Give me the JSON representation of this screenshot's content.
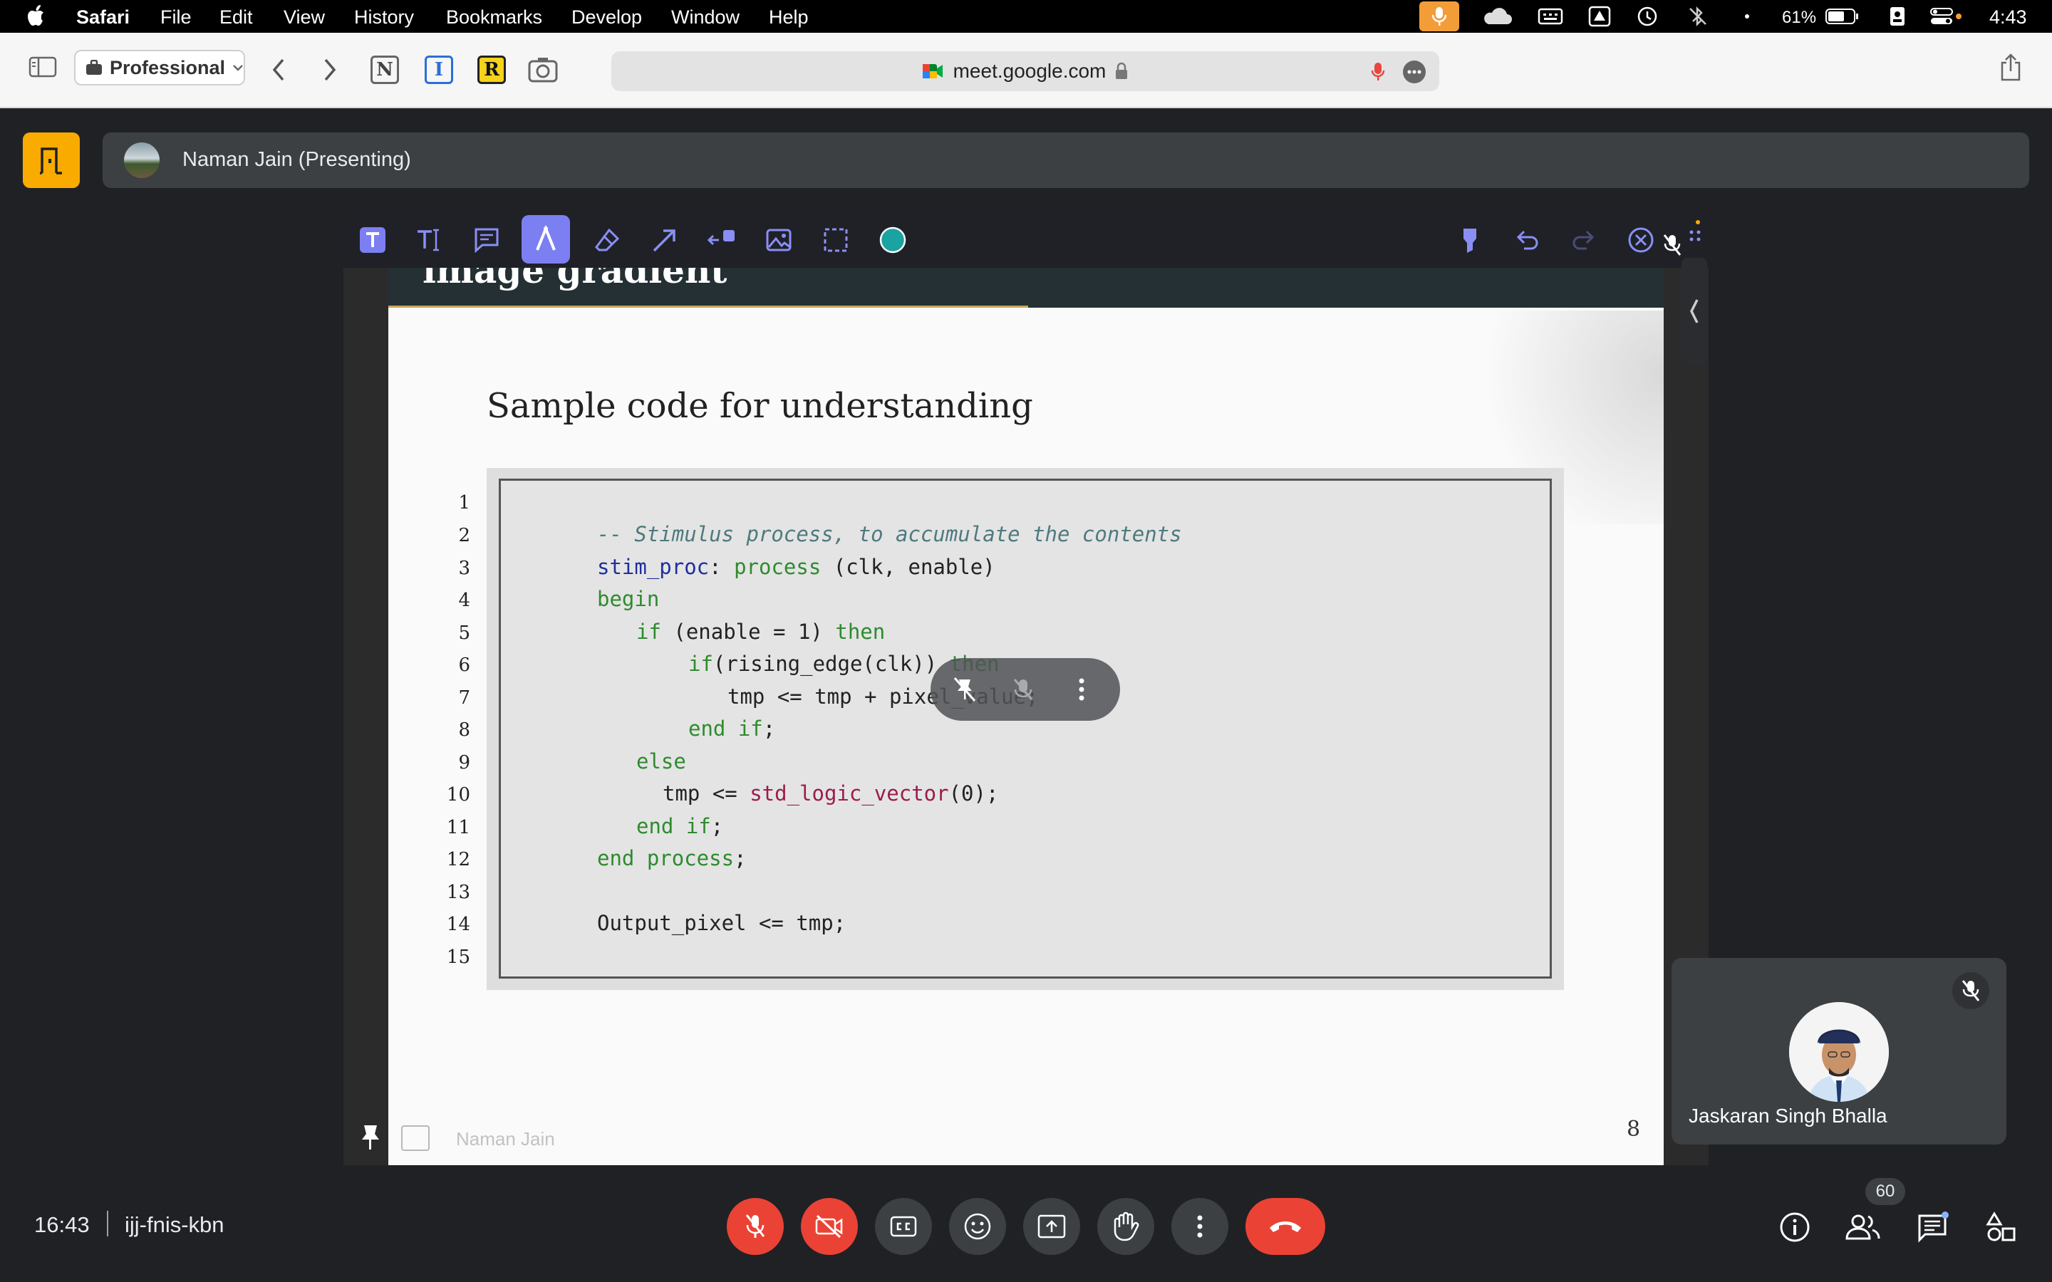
{
  "menubar": {
    "app": "Safari",
    "items": [
      "File",
      "Edit",
      "View",
      "History",
      "Bookmarks",
      "Develop",
      "Window",
      "Help"
    ],
    "battery": "61%",
    "clock": "4:43"
  },
  "toolbar": {
    "profile": "Professional",
    "url": "meet.google.com",
    "ext_n": "N",
    "ext_i": "I",
    "ext_r": "R"
  },
  "meet": {
    "presenter_title": "Naman Jain (Presenting)",
    "participant_name": "Jaskaran Singh Bhalla",
    "time": "16:43",
    "meeting_code": "ijj-fnis-kbn",
    "people_count": "60"
  },
  "slide": {
    "header_partial": "image gradient",
    "heading": "Sample code for understanding",
    "page_number": "8",
    "footer_author": "Naman Jain",
    "line_numbers": [
      "1",
      "2",
      "3",
      "4",
      "5",
      "6",
      "7",
      "8",
      "9",
      "10",
      "11",
      "12",
      "13",
      "14",
      "15"
    ],
    "code": {
      "l2": "-- Stimulus process, to accumulate the contents",
      "l3_id": "stim_proc",
      "l3_sep": ": ",
      "l3_kw": "process",
      "l3_rest": " (clk, enable)",
      "l4": "begin",
      "l5_kw1": "if",
      "l5_mid": " (enable = 1) ",
      "l5_kw2": "then",
      "l6_kw1": "if",
      "l6_mid": "(rising_edge(clk)) ",
      "l6_kw2": "then",
      "l7": "tmp <= tmp + pixel_value;",
      "l8_kw": "end if",
      "l8_end": ";",
      "l9": "else",
      "l10_a": "tmp <= ",
      "l10_fn": "std_logic_vector",
      "l10_b": "(0);",
      "l11_kw": "end if",
      "l11_end": ";",
      "l12_kw": "end process",
      "l12_end": ";",
      "l14": "Output_pixel <= tmp;"
    }
  },
  "colors": {
    "accent_yellow": "#f9ab00",
    "danger_red": "#ea4335",
    "annotation_purple": "#7c7ff2"
  }
}
